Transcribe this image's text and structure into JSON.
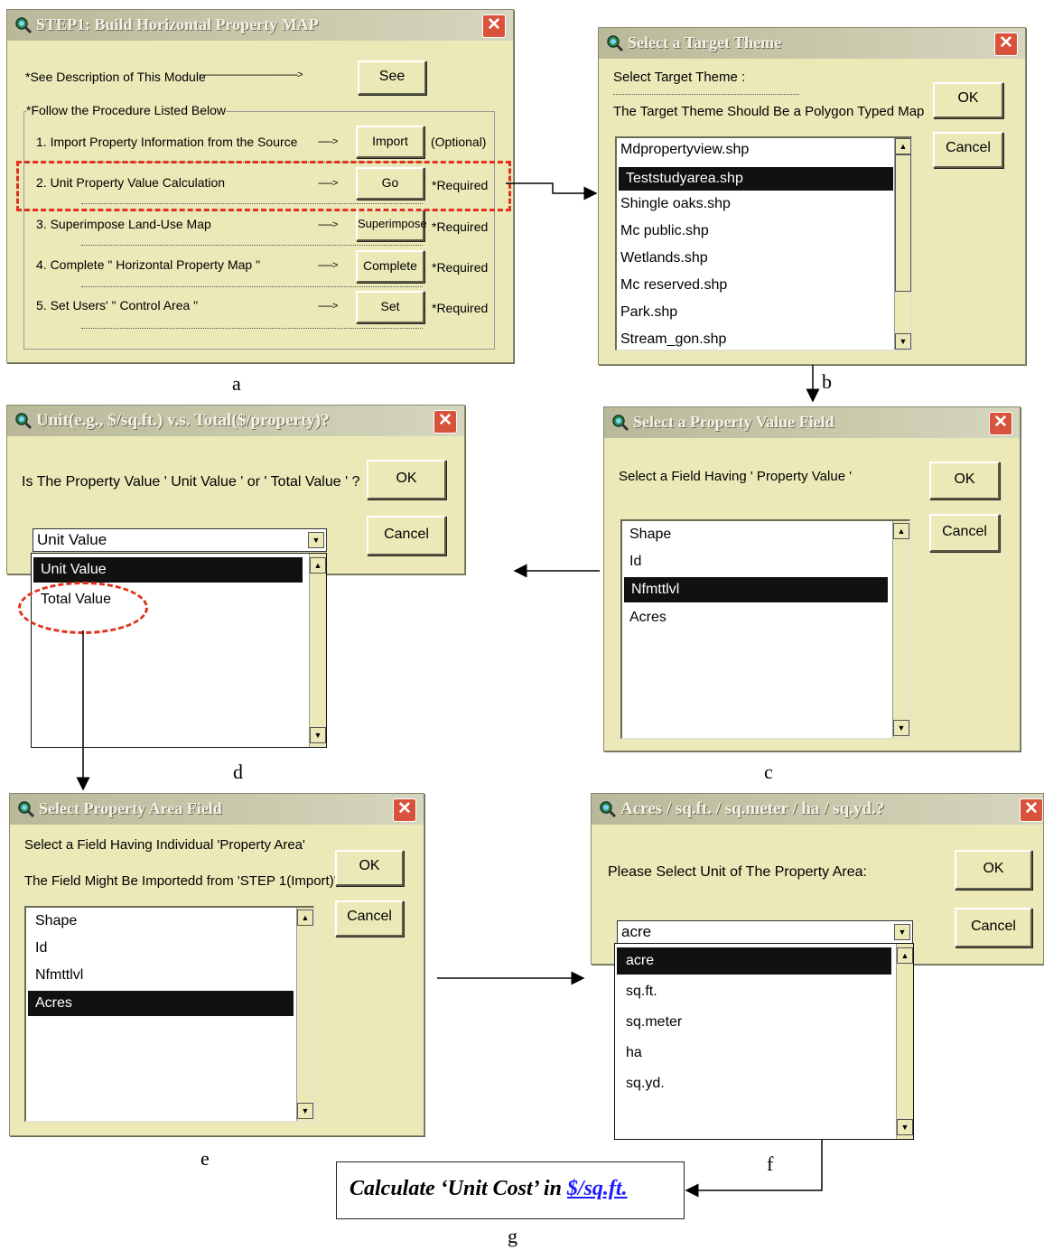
{
  "dialog_a": {
    "title": "STEP1: Build Horizontal Property MAP",
    "see_text": "*See Description of This Module",
    "see_arrow": "----------------------------------------->",
    "see_button": "See",
    "group_label": "*Follow the Procedure Listed Below",
    "steps": [
      {
        "label": "1.  Import Property Information from the Source",
        "arrow": "------>",
        "button": "Import",
        "note": "(Optional)"
      },
      {
        "label": "2.  Unit Property Value Calculation",
        "arrow": "------>",
        "button": "Go",
        "note": "*Required"
      },
      {
        "label": "3.  Superimpose Land-Use Map",
        "arrow": "------>",
        "button": "Superimpose",
        "note": "*Required"
      },
      {
        "label": "4.  Complete \" Horizontal Property Map \"",
        "arrow": "------>",
        "button": "Complete",
        "note": "*Required"
      },
      {
        "label": "5.  Set Users'  \" Control Area \"",
        "arrow": "------>",
        "button": "Set",
        "note": "*Required"
      }
    ]
  },
  "dialog_b": {
    "title": "Select a Target Theme",
    "prompt": "Select Target Theme :",
    "note": "The Target Theme Should Be a Polygon Typed Map",
    "ok": "OK",
    "cancel": "Cancel",
    "items": [
      "Mdpropertyview.shp",
      "Teststudyarea.shp",
      "Shingle oaks.shp",
      "Mc public.shp",
      "Wetlands.shp",
      "Mc reserved.shp",
      "Park.shp",
      "Stream_gon.shp"
    ],
    "selected": "Teststudyarea.shp"
  },
  "dialog_c": {
    "title": "Select a Property Value Field",
    "prompt": "Select a Field Having ' Property Value '",
    "ok": "OK",
    "cancel": "Cancel",
    "items": [
      "Shape",
      "Id",
      "Nfmttlvl",
      "Acres"
    ],
    "selected": "Nfmttlvl"
  },
  "dialog_d": {
    "title": "Unit(e.g., $/sq.ft.) v.s. Total($/property)?",
    "prompt": "Is The Property Value ' Unit Value ' or ' Total Value ' ?",
    "ok": "OK",
    "cancel": "Cancel",
    "combo_value": "Unit Value",
    "options": [
      "Unit Value",
      "Total Value"
    ],
    "selected": "Unit Value"
  },
  "dialog_e": {
    "title": "Select Property Area Field",
    "prompt": "Select a Field Having Individual 'Property Area'",
    "note": "The Field Might Be Importedd from 'STEP 1(Import)'",
    "ok": "OK",
    "cancel": "Cancel",
    "items": [
      "Shape",
      "Id",
      "Nfmttlvl",
      "Acres"
    ],
    "selected": "Acres"
  },
  "dialog_f": {
    "title": "Acres / sq.ft. / sq.meter / ha / sq.yd.?",
    "prompt": "Please Select Unit of The Property Area:",
    "ok": "OK",
    "cancel": "Cancel",
    "combo_value": "acre",
    "options": [
      "acre",
      "sq.ft.",
      "sq.meter",
      "ha",
      "sq.yd."
    ],
    "selected": "acre"
  },
  "result_box": {
    "prefix": "Calculate ‘Unit Cost’ in ",
    "unit": "$/sq.ft."
  },
  "captions": {
    "a": "a",
    "b": "b",
    "c": "c",
    "d": "d",
    "e": "e",
    "f": "f",
    "g": "g"
  },
  "colors": {
    "dialog_bg": "#ece9b8",
    "highlight_dash": "#e0321c",
    "close_button": "#d9533c",
    "selection": "#111111",
    "link": "#1a1aff"
  }
}
